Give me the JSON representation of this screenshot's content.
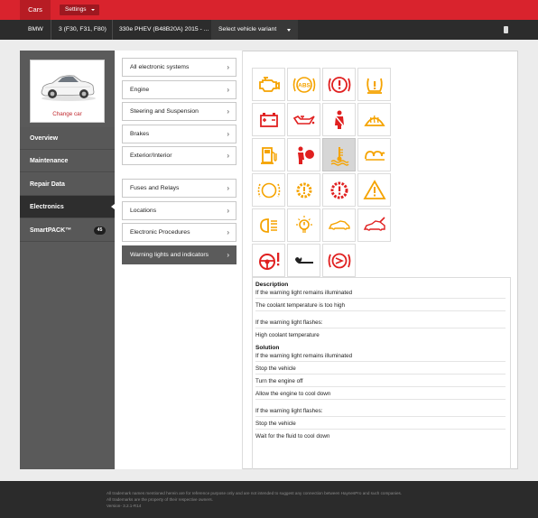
{
  "topbar": {
    "cars_tab": "Cars",
    "settings_label": "Settings"
  },
  "breadcrumb": {
    "make": "BMW",
    "model": "3 (F30, F31, F80)",
    "engine": "330e PHEV (B48B20A) 2015 - ...",
    "variant": "Select vehicle variant"
  },
  "sidebar": {
    "change_car": "Change car",
    "items": [
      {
        "label": "Overview"
      },
      {
        "label": "Maintenance"
      },
      {
        "label": "Repair Data"
      },
      {
        "label": "Electronics"
      },
      {
        "label": "SmartPACK™",
        "badge": "45"
      }
    ]
  },
  "menu": {
    "group1": [
      {
        "label": "All electronic systems"
      },
      {
        "label": "Engine"
      },
      {
        "label": "Steering and Suspension"
      },
      {
        "label": "Brakes"
      },
      {
        "label": "Exterior/Interior"
      }
    ],
    "group2": [
      {
        "label": "Fuses and Relays"
      },
      {
        "label": "Locations"
      },
      {
        "label": "Electronic Procedures"
      },
      {
        "label": "Warning lights and indicators"
      }
    ]
  },
  "warning_icons": [
    {
      "name": "engine-warning-icon",
      "color": "#f5a300"
    },
    {
      "name": "abs-warning-icon",
      "color": "#f5a300"
    },
    {
      "name": "brake-warning-icon",
      "color": "#e02020"
    },
    {
      "name": "tyre-pressure-icon",
      "color": "#f5a300"
    },
    {
      "name": "battery-warning-icon",
      "color": "#e02020"
    },
    {
      "name": "oil-pressure-icon",
      "color": "#e02020"
    },
    {
      "name": "seatbelt-warning-icon",
      "color": "#e02020"
    },
    {
      "name": "windscreen-heating-icon",
      "color": "#f5a300"
    },
    {
      "name": "fuel-warning-icon",
      "color": "#f5a300"
    },
    {
      "name": "airbag-warning-icon",
      "color": "#e02020"
    },
    {
      "name": "coolant-temperature-icon",
      "color": "#f5a300"
    },
    {
      "name": "glow-plug-icon",
      "color": "#f5a300"
    },
    {
      "name": "brake-pad-wear-icon",
      "color": "#f5a300"
    },
    {
      "name": "gearbox-warning-icon",
      "color": "#f5a300"
    },
    {
      "name": "hybrid-system-warning-icon",
      "color": "#e02020"
    },
    {
      "name": "general-warning-icon",
      "color": "#f5a300"
    },
    {
      "name": "headlight-range-icon",
      "color": "#f5a300"
    },
    {
      "name": "exterior-bulb-failure-icon",
      "color": "#f5a300"
    },
    {
      "name": "vehicle-lift-icon",
      "color": "#f5a300"
    },
    {
      "name": "bonnet-open-icon",
      "color": "#e02020"
    },
    {
      "name": "steering-warning-icon",
      "color": "#e02020"
    },
    {
      "name": "service-wrench-icon",
      "color": "#222222"
    },
    {
      "name": "parking-brake-icon",
      "color": "#e02020"
    }
  ],
  "description": {
    "heading": "Description",
    "lines1": [
      "If the warning light remains illuminated",
      "The coolant temperature is too high"
    ],
    "lines2": [
      "If the warning light flashes:",
      "High coolant temperature"
    ],
    "solution_heading": "Solution",
    "lines3": [
      "If the warning light remains illuminated",
      "Stop the vehicle",
      "Turn the engine off",
      "Allow the engine to cool down"
    ],
    "lines4": [
      "If the warning light flashes:",
      "Stop the vehicle",
      "Wait for the fluid to cool down"
    ]
  },
  "footer": {
    "line1": "All trademark names mentioned herein are for reference purpose only and are not intended to suggest any connection between HaynesPro and such companies.",
    "line2": "All trademarks are the property of their respective owners.",
    "version": "Version- 3.2.1-R14"
  }
}
